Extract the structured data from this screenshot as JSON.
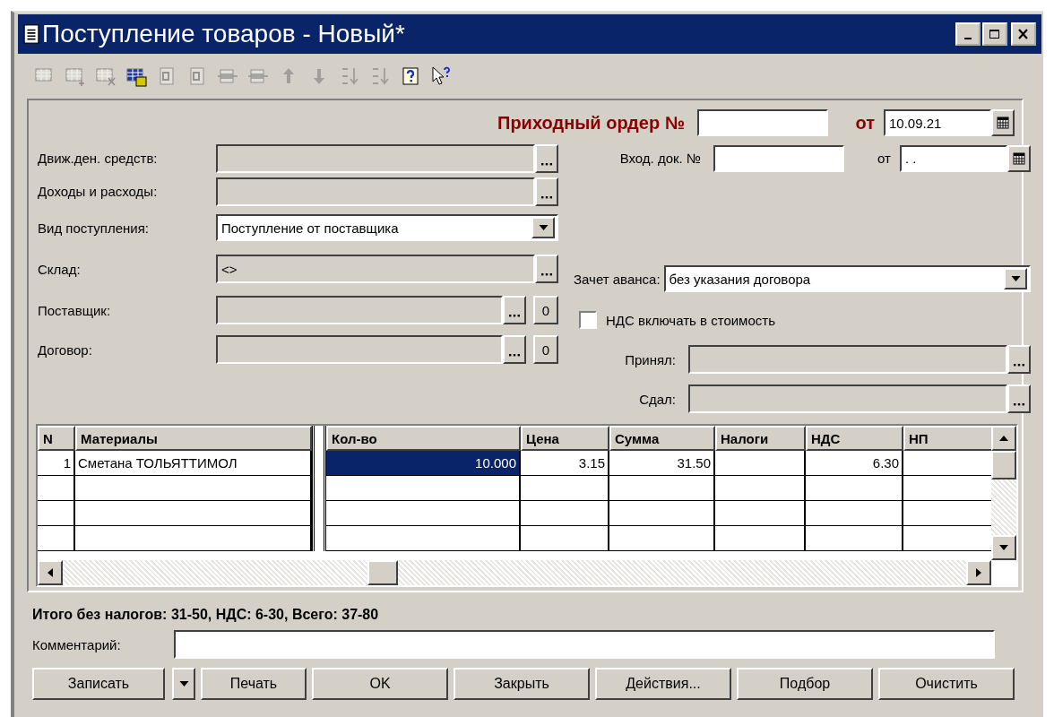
{
  "window": {
    "title": "Поступление товаров - Новый*"
  },
  "toolbar": [
    {
      "kind": "grid",
      "disabled": true
    },
    {
      "kind": "grid-add",
      "disabled": true
    },
    {
      "kind": "grid-edit",
      "disabled": true
    },
    {
      "kind": "grid-save",
      "disabled": false
    },
    {
      "kind": "doc",
      "disabled": true
    },
    {
      "kind": "doc-cut",
      "disabled": true
    },
    {
      "kind": "row-edit",
      "disabled": true
    },
    {
      "kind": "row-insert",
      "disabled": true
    },
    {
      "kind": "up",
      "disabled": true
    },
    {
      "kind": "down",
      "disabled": true
    },
    {
      "kind": "sort-asc",
      "disabled": true
    },
    {
      "kind": "sort-desc",
      "disabled": true
    },
    {
      "kind": "help",
      "disabled": false
    },
    {
      "kind": "pointer-help",
      "disabled": false
    }
  ],
  "header": {
    "title": "Приходный ордер №",
    "date_label": "от",
    "date": "10.09.21"
  },
  "incoming": {
    "label": "Вход. док. №",
    "date_label": "от",
    "date": ". ."
  },
  "left_fields": [
    {
      "label": "Движ.ден. средств:",
      "kind": "choice",
      "disabled": true
    },
    {
      "label": "Доходы и расходы:",
      "kind": "choice",
      "disabled": true
    },
    {
      "label": "Вид поступления:",
      "kind": "select",
      "value": "Поступление от поставщика",
      "disabled": false
    },
    {
      "label": "Склад:",
      "kind": "choice",
      "value": "<>",
      "disabled": true
    },
    {
      "label": "Поставщик:",
      "kind": "choice-clear",
      "clear": "0",
      "disabled": true
    },
    {
      "label": "Договор:",
      "kind": "choice-clear",
      "clear": "0",
      "disabled": true
    }
  ],
  "advance": {
    "label": "Зачет аванса:",
    "value": "без указания договора"
  },
  "vat_checkbox": {
    "label": "НДС включать в стоимость",
    "checked": false
  },
  "people": [
    {
      "label": "Принял:",
      "disabled": true
    },
    {
      "label": "Сдал:",
      "disabled": true
    }
  ],
  "table": {
    "columns": [
      "N",
      "Материалы",
      "Кол-во",
      "Цена",
      "Сумма",
      "Налоги",
      "НДС",
      "НП"
    ],
    "rows": [
      {
        "cells": [
          {
            "text": "1",
            "selected": false
          },
          {
            "text": "Сметана ТОЛЬЯТТИМОЛ",
            "selected": false
          },
          {
            "text": "10.000",
            "selected": true
          },
          {
            "text": "3.15",
            "selected": false
          },
          {
            "text": "31.50",
            "selected": false
          },
          {
            "selected": false
          },
          {
            "text": "6.30",
            "selected": false
          },
          {
            "selected": false
          }
        ]
      }
    ]
  },
  "totals": "Итого без налогов: 31-50, НДС: 6-30, Всего: 37-80",
  "comment": {
    "label": "Комментарий:"
  },
  "buttons": [
    {
      "kind": "button",
      "label": "Записать"
    },
    {
      "kind": "menu"
    },
    {
      "kind": "button",
      "label": "Печать"
    },
    {
      "kind": "button",
      "label": "OK"
    },
    {
      "kind": "button",
      "label": "Закрыть"
    },
    {
      "kind": "button",
      "label": "Действия..."
    },
    {
      "kind": "button",
      "label": "Подбор"
    },
    {
      "kind": "button",
      "label": "Очистить"
    }
  ]
}
